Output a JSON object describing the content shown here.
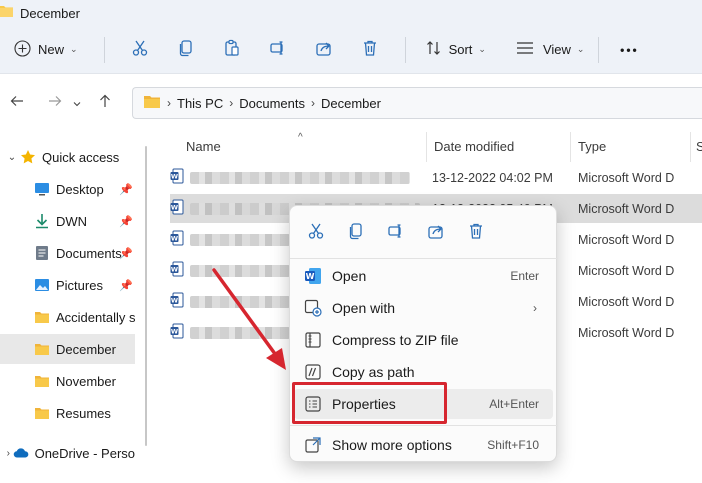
{
  "window": {
    "title": "December"
  },
  "toolbar": {
    "new_label": "New",
    "cut_icon": "scissors-icon",
    "copy_icon": "copy-icon",
    "paste_icon": "paste-icon",
    "rename_icon": "rename-icon",
    "share_icon": "share-icon",
    "delete_icon": "trash-icon",
    "sort_label": "Sort",
    "view_label": "View",
    "more_label": "•••"
  },
  "address": {
    "crumbs": [
      "This PC",
      "Documents",
      "December"
    ]
  },
  "sidebar": {
    "items": [
      {
        "label": "Quick access",
        "icon": "star-icon",
        "pinned": false
      },
      {
        "label": "Desktop",
        "icon": "desktop-icon",
        "pinned": true
      },
      {
        "label": "DWN",
        "icon": "download-icon",
        "pinned": true
      },
      {
        "label": "Documents",
        "icon": "documents-icon",
        "pinned": true
      },
      {
        "label": "Pictures",
        "icon": "pictures-icon",
        "pinned": true
      },
      {
        "label": "Accidentally sa",
        "icon": "folder-icon",
        "pinned": false
      },
      {
        "label": "December",
        "icon": "folder-icon",
        "pinned": false,
        "selected": true
      },
      {
        "label": "November",
        "icon": "folder-icon",
        "pinned": false
      },
      {
        "label": "Resumes",
        "icon": "folder-icon",
        "pinned": false
      },
      {
        "label": "OneDrive - Perso",
        "icon": "cloud-icon",
        "pinned": false
      }
    ]
  },
  "columns": {
    "name": "Name",
    "date": "Date modified",
    "type": "Type",
    "size": "S"
  },
  "files": [
    {
      "date": "13-12-2022 04:02 PM",
      "type": "Microsoft Word D"
    },
    {
      "date": "13-12-2022 05:40 PM",
      "type": "Microsoft Word D",
      "selected": true
    },
    {
      "date": "",
      "type": "Microsoft Word D"
    },
    {
      "date": "",
      "type": "Microsoft Word D"
    },
    {
      "date": "",
      "type": "Microsoft Word D"
    },
    {
      "date": "",
      "type": "Microsoft Word D"
    }
  ],
  "context_menu": {
    "icons": [
      "scissors-icon",
      "copy-icon",
      "rename-icon",
      "share-icon",
      "trash-icon"
    ],
    "items": {
      "open": {
        "label": "Open",
        "shortcut": "Enter"
      },
      "open_with": {
        "label": "Open with"
      },
      "compress": {
        "label": "Compress to ZIP file"
      },
      "copy_path": {
        "label": "Copy as path"
      },
      "properties": {
        "label": "Properties",
        "shortcut": "Alt+Enter"
      },
      "more_options": {
        "label": "Show more options",
        "shortcut": "Shift+F10"
      }
    }
  },
  "colors": {
    "accent": "#0078d4",
    "folder": "#f8c94a",
    "highlight": "#d6262f",
    "word_blue": "#2b579a"
  }
}
